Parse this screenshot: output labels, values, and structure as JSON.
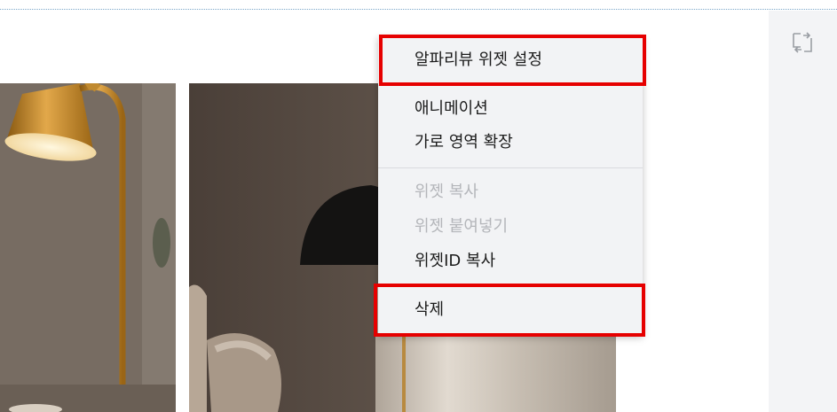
{
  "context_menu": {
    "items": [
      {
        "label": "알파리뷰 위젯 설정",
        "enabled": true
      },
      {
        "label": "애니메이션",
        "enabled": true
      },
      {
        "label": "가로 영역 확장",
        "enabled": true
      },
      {
        "label": "위젯 복사",
        "enabled": false
      },
      {
        "label": "위젯 붙여넣기",
        "enabled": false
      },
      {
        "label": "위젯ID 복사",
        "enabled": true
      },
      {
        "label": "삭제",
        "enabled": true
      }
    ]
  },
  "panel": {
    "icon": "swap-icon"
  },
  "highlight_color": "#e60000"
}
